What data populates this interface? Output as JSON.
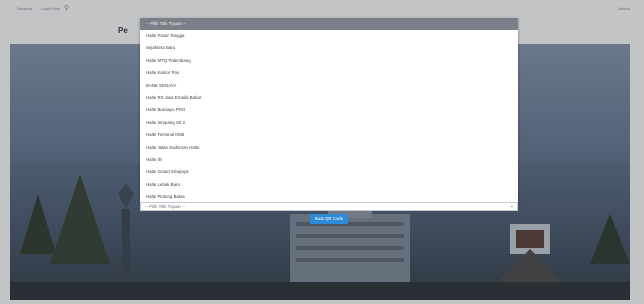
{
  "header": {
    "nav": [
      "Beranda",
      "Login Web"
    ],
    "search_icon": "search-icon",
    "right_link": "Masuk"
  },
  "page": {
    "title": "Pe"
  },
  "dropdown": {
    "placeholder": "-- Pilih Titik Tujuan --",
    "options": [
      "Halte Pasar Tangga",
      "Sejahtera Baru",
      "Halte MTQ Palembang",
      "Halte Kantor Pos",
      "BANK SENAYA",
      "Halte RS Jiwa Ernaldi Bahar",
      "Halte Bumiayu PRO",
      "Halte Simpang Sit 3",
      "Halte Terminal KM5",
      "Halte Jalan Sudirman Halte",
      "Halte Ilir",
      "Halte Grand Sriwijaya",
      "Halte Lebak Baru",
      "Halte Pintung Batas"
    ]
  },
  "select2": {
    "value": "-- Pilih Titik Tujuan --",
    "chevron_icon": "chevron-down-icon"
  },
  "button": {
    "label": "Buat QR Code"
  }
}
